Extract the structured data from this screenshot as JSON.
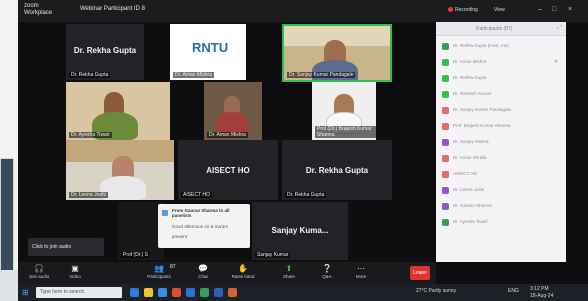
{
  "window": {
    "app_name": "zoom Workplace",
    "title": "Webinar Participant ID 8",
    "recording": "Recording",
    "view": "View"
  },
  "tiles": {
    "t1_title": "Dr. Rekha Gupta",
    "t1_name": "Dr. Rekha Gupta",
    "t2_logo": "RNTU",
    "t2_name": "Dr. Aman Mishra",
    "t3_name": "Dr. Sanjay Kumar Pandagale",
    "t4_name": "Dr. Ayesha Tiwari",
    "t5_name": "Dr. Aman Mishra",
    "t6_name": "Prof.(Dr.) Brajesh Kumar Sharma",
    "t7_name": "Dr. Leena Joshi",
    "t8_title": "AISECT HO",
    "t8_name": "AISECT HO",
    "t9_title": "Dr. Rekha Gupta",
    "t9_name": "Dr. Rekha Gupta",
    "t10_name": "Prof (Dr.) S",
    "t11_title": "Sanjay Kuma...",
    "t11_name": "Sanjay Kumar"
  },
  "chat_toast": {
    "from": "From Gaurav Sharma to all panelists",
    "line1": "Good afternoon sir & ma'am",
    "line2": "present"
  },
  "click_to_join": "Click to join audio",
  "participants": {
    "title": "Participants (87)",
    "rows": [
      "Dr. Rekha Gupta (Host, me)",
      "Dr. Aman Mishra",
      "Dr. Rekha Gupta",
      "Dr. Ramesh Kumar",
      "Dr. Sanjay Kumar Pandagale",
      "Prof. Brajesh Kumar Sharma",
      "Dr. Sanjay Mishra",
      "Dr. Aman Shukla",
      "AISECT HO",
      "Dr. Leena Joshi",
      "Dr. Gaurav Sharma",
      "Dr. Ayesha Tiwari"
    ]
  },
  "toolbar": {
    "join_audio": "Join audio",
    "video": "Video",
    "participants": "Participants",
    "participants_count": "87",
    "chat": "Chat",
    "raise_hand": "Raise hand",
    "share": "Share",
    "qa": "Q&A",
    "more": "More",
    "leave": "Leave"
  },
  "taskbar": {
    "search_placeholder": "Type here to search",
    "weather": "27°C Partly sunny",
    "lang": "ENG",
    "time": "3:12 PM",
    "date": "18-Aug-24"
  },
  "colors": {
    "accent_green": "#2fbf4e",
    "end_red": "#d33333",
    "rntu_blue": "#2c6ab0"
  }
}
